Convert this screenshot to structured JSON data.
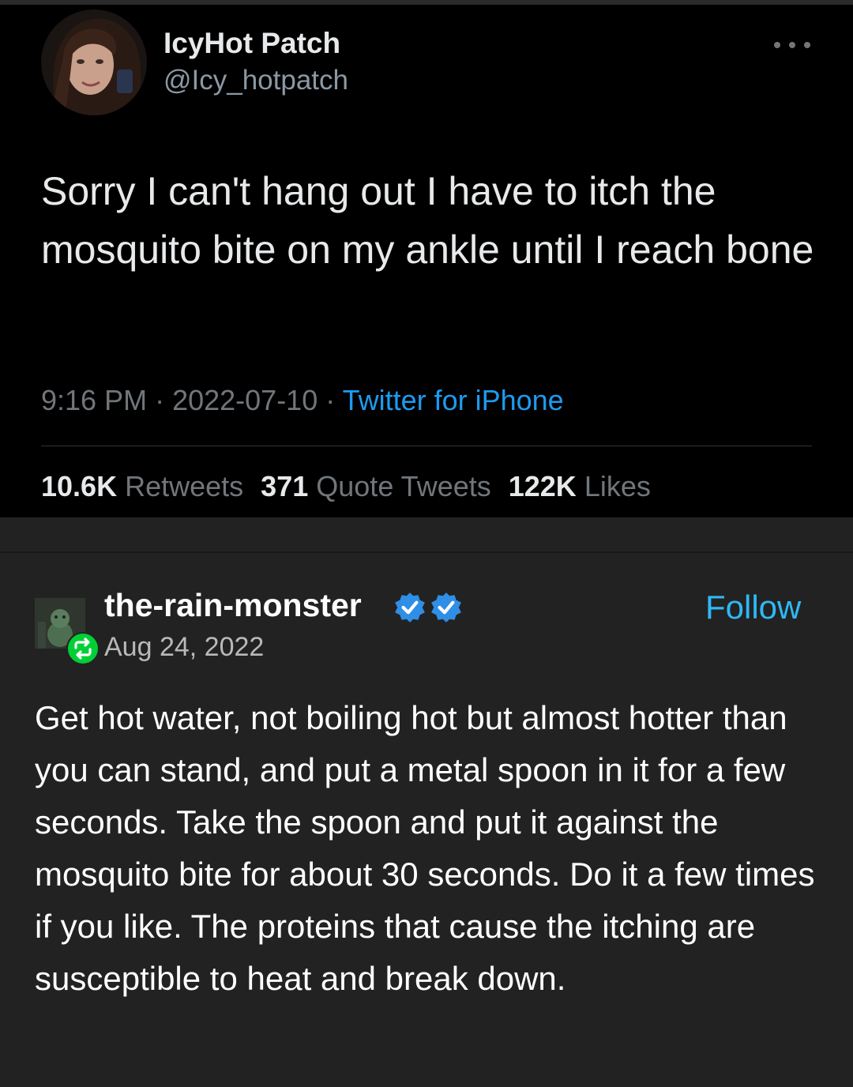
{
  "tweet": {
    "display_name": "IcyHot Patch",
    "handle": "@Icy_hotpatch",
    "text": "Sorry I can't hang out I have to itch the mosquito bite on my ankle until I reach bone",
    "time": "9:16 PM",
    "date": "2022-07-10",
    "source": "Twitter for iPhone",
    "separator": " · ",
    "stats": {
      "retweets_count": "10.6K",
      "retweets_label": "Retweets",
      "quotes_count": "371",
      "quotes_label": "Quote Tweets",
      "likes_count": "122K",
      "likes_label": "Likes"
    },
    "icons": {
      "more": "more-horizontal-icon"
    },
    "colors": {
      "link": "#1d9bf0",
      "muted": "#71767b",
      "text": "#e7e9ea"
    }
  },
  "tumblr_post": {
    "blog_name": "the-rain-monster",
    "date": "Aug 24, 2022",
    "follow_label": "Follow",
    "text": "Get hot water, not boiling hot but almost hotter than you can stand, and put a metal spoon in it for a few seconds. Take the spoon and put it against the mosquito bite for about 30 seconds. Do it a few times if you like. The proteins that cause the itching are susceptible to heat and break down.",
    "icons": {
      "reblog": "reblog-icon",
      "verified": "verified-badge-icon"
    },
    "colors": {
      "follow": "#2fb8f6",
      "verified": "#2f8ee6",
      "reblog": "#00cf35",
      "background": "#222222"
    }
  }
}
